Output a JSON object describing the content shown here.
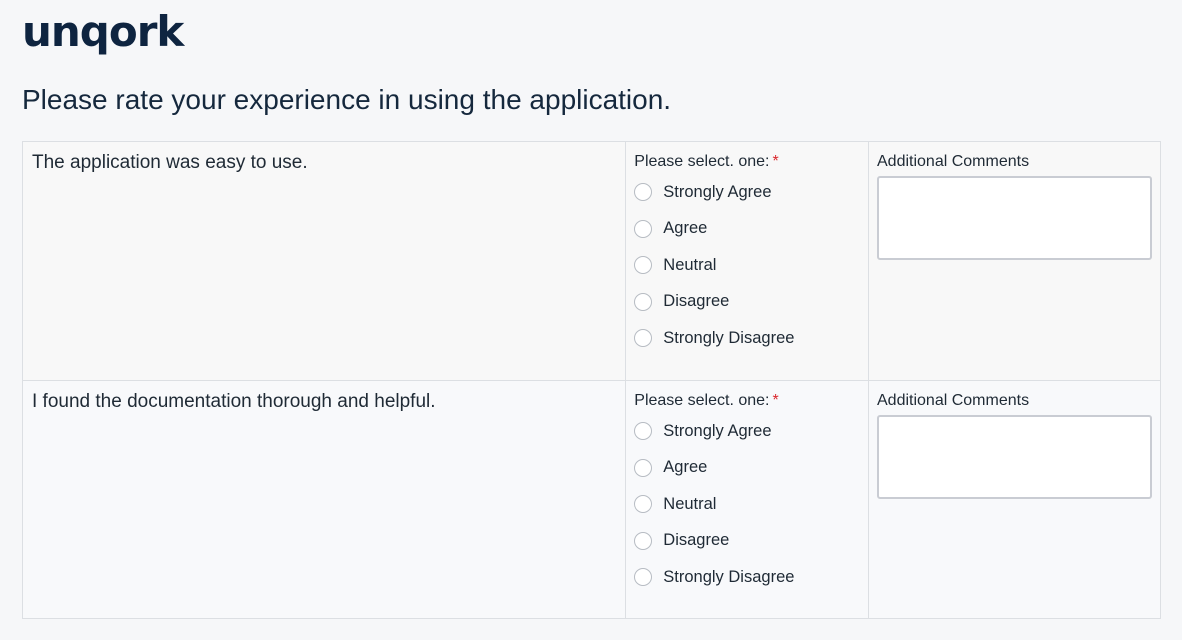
{
  "brand": {
    "logo_text": "unqork"
  },
  "page_title": "Please rate your experience in using the application.",
  "questions": [
    {
      "statement": "The application was easy to use.",
      "select_label": "Please select. one:",
      "required_marker": "*",
      "options": [
        "Strongly Agree",
        "Agree",
        "Neutral",
        "Disagree",
        "Strongly Disagree"
      ],
      "selected": null,
      "comments_label": "Additional Comments",
      "comments_value": ""
    },
    {
      "statement": "I found the documentation thorough and helpful.",
      "select_label": "Please select. one:",
      "required_marker": "*",
      "options": [
        "Strongly Agree",
        "Agree",
        "Neutral",
        "Disagree",
        "Strongly Disagree"
      ],
      "selected": null,
      "comments_label": "Additional Comments",
      "comments_value": ""
    }
  ],
  "colors": {
    "brand_navy": "#0e2440",
    "required_red": "#d9262b",
    "border_gray": "#dcdfe3"
  }
}
